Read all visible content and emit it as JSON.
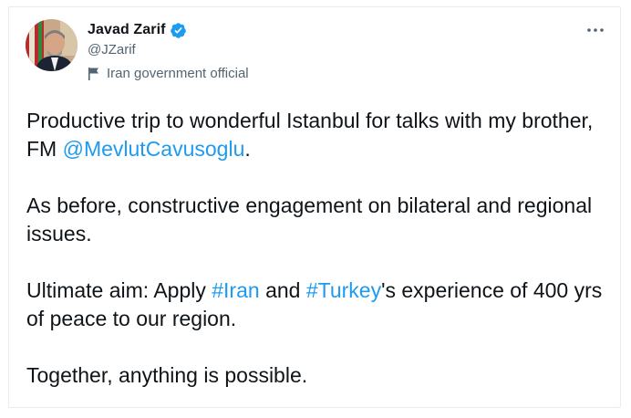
{
  "author": {
    "display_name": "Javad Zarif",
    "handle": "@JZarif",
    "label": "Iran government official",
    "verified": true
  },
  "menu": {
    "more_icon": "more-horizontal-icon"
  },
  "tweet": {
    "p1_a": "Productive trip to wonderful Istanbul for talks with my brother, FM ",
    "p1_mention": "@MevlutCavusoglu",
    "p1_b": ".",
    "p2": "As before, constructive engagement on bilateral and regional issues.",
    "p3_a": "Ultimate aim: Apply ",
    "p3_tag1": "#Iran",
    "p3_b": " and ",
    "p3_tag2": "#Turkey",
    "p3_c": "'s experience of 400 yrs of peace to our region.",
    "p4": "Together, anything is possible."
  },
  "colors": {
    "link": "#1d9bf0",
    "text": "#0f1419",
    "secondary": "#536471",
    "verified": "#1d9bf0"
  }
}
